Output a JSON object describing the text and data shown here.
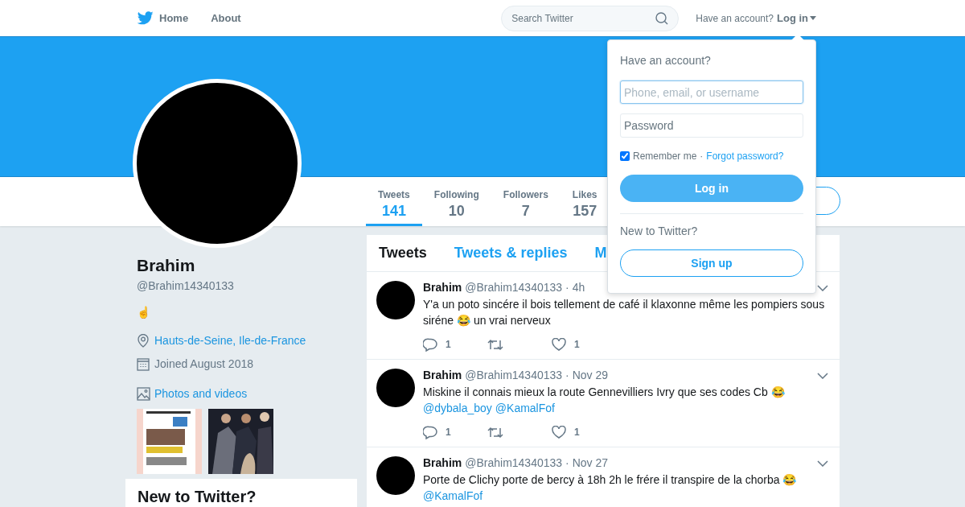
{
  "nav": {
    "items": [
      {
        "label": "Home",
        "selected": false
      },
      {
        "label": "About",
        "selected": false
      }
    ],
    "search": {
      "placeholder": "Search Twitter"
    },
    "account_prompt": "Have an account?",
    "login_label": "Log in"
  },
  "stats": [
    {
      "label": "Tweets",
      "value": "141",
      "selected": true
    },
    {
      "label": "Following",
      "value": "10",
      "selected": false
    },
    {
      "label": "Followers",
      "value": "7",
      "selected": false
    },
    {
      "label": "Likes",
      "value": "157",
      "selected": false
    }
  ],
  "profile": {
    "name": "Brahim",
    "handle": "@Brahim14340133",
    "bio": "☝",
    "location": "Hauts-de-Seine, Ile-de-France",
    "joined": "Joined August 2018",
    "photos_link": "Photos and videos"
  },
  "signup_card": {
    "title": "New to Twitter?"
  },
  "timeline_tabs": [
    {
      "label": "Tweets",
      "selected": true
    },
    {
      "label": "Tweets & replies",
      "selected": false
    },
    {
      "label": "M",
      "selected": false
    }
  ],
  "tweets": [
    {
      "name": "Brahim",
      "handle": "@Brahim14340133",
      "time": "· 4h",
      "text": "Y'a un poto sincére il bois tellement de café il klaxonne même les pompiers sous siréne 😂 un vrai nerveux",
      "replies": "1",
      "likes": "1"
    },
    {
      "name": "Brahim",
      "handle": "@Brahim14340133",
      "time": "· Nov 29",
      "text": "Miskine il connais mieux la route Gennevilliers Ivry que ses codes Cb 😂",
      "mentions": [
        "@dybala_boy",
        "@KamalFof"
      ],
      "replies": "1",
      "likes": "1"
    },
    {
      "name": "Brahim",
      "handle": "@Brahim14340133",
      "time": "· Nov 27",
      "text": "Porte de Clichy porte de bercy à 18h 2h le frére il transpire de la chorba 😂",
      "mentions": [
        "@KamalFof"
      ]
    }
  ],
  "login_dropdown": {
    "title": "Have an account?",
    "username": {
      "placeholder": "Phone, email, or username"
    },
    "password": {
      "placeholder": "Password"
    },
    "remember": {
      "label": "Remember me",
      "checked": true
    },
    "separator": "·",
    "forgot": "Forgot password?",
    "login_button": "Log in",
    "new_prompt": "New to Twitter?",
    "signup_button": "Sign up"
  }
}
